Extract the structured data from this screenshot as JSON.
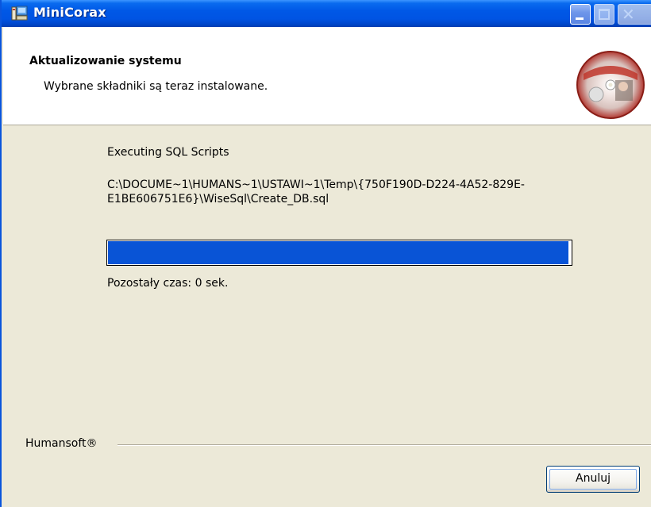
{
  "window": {
    "title": "MiniCorax"
  },
  "header": {
    "title": "Aktualizowanie systemu",
    "subtitle": "Wybrane składniki są teraz instalowane."
  },
  "main": {
    "status_label": "Executing SQL Scripts",
    "current_path": "C:\\DOCUME~1\\HUMANS~1\\USTAWI~1\\Temp\\{750F190D-D224-4A52-829E-E1BE606751E6}\\WiseSql\\Create_DB.sql",
    "progress_fraction": 0.995,
    "remaining_time": "Pozostały czas: 0 sek."
  },
  "footer": {
    "brand": "Humansoft®",
    "cancel_label": "Anuluj"
  },
  "icons": {
    "app": "installer-app-icon",
    "logo": "cd-disc-logo-icon",
    "minimize": "minimize-icon",
    "maximize": "maximize-icon",
    "close": "close-icon"
  },
  "colors": {
    "titlebar": "#0054E3",
    "progress": "#0954D6",
    "dialog_bg": "#ECE9D8"
  }
}
